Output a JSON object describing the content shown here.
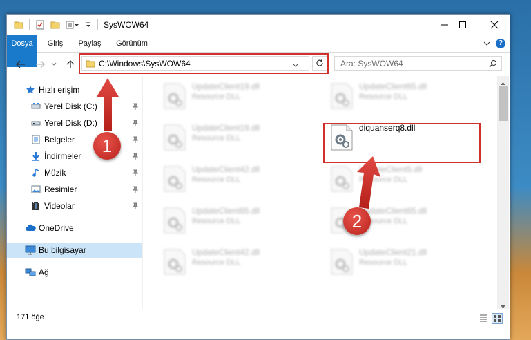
{
  "window": {
    "title": "SysWOW64",
    "controls": {
      "minimize": "—",
      "maximize": "☐",
      "close": "✕"
    }
  },
  "ribbon": {
    "tabs": [
      {
        "label": "Dosya",
        "active": true
      },
      {
        "label": "Giriş"
      },
      {
        "label": "Paylaş"
      },
      {
        "label": "Görünüm"
      }
    ],
    "help_label": "?"
  },
  "navigation": {
    "address": "C:\\Windows\\SysWOW64",
    "search_placeholder": "Ara: SysWOW64"
  },
  "sidebar": {
    "items": [
      {
        "label": "Hızlı erişim",
        "icon": "star-icon",
        "pinned": false
      },
      {
        "label": "Yerel Disk (C:)",
        "icon": "disk-icon",
        "pinned": true
      },
      {
        "label": "Yerel Disk (D:)",
        "icon": "disk-icon",
        "pinned": true
      },
      {
        "label": "Belgeler",
        "icon": "documents-icon",
        "pinned": true
      },
      {
        "label": "İndirmeler",
        "icon": "download-icon",
        "pinned": true
      },
      {
        "label": "Müzik",
        "icon": "music-icon",
        "pinned": true
      },
      {
        "label": "Resimler",
        "icon": "pictures-icon",
        "pinned": true
      },
      {
        "label": "Videolar",
        "icon": "video-icon",
        "pinned": true
      },
      {
        "label": "OneDrive",
        "icon": "cloud-icon",
        "pinned": false
      },
      {
        "label": "Bu bilgisayar",
        "icon": "computer-icon",
        "pinned": false,
        "selected": true
      },
      {
        "label": "Ağ",
        "icon": "network-icon",
        "pinned": false
      }
    ]
  },
  "files": [
    {
      "name": "UpdateClient19.dll",
      "type": "Resource DLL",
      "blurred": true
    },
    {
      "name": "UpdateClient65.dll",
      "type": "Resource DLL",
      "blurred": true
    },
    {
      "name": "UpdateClient19.dll",
      "type": "Resource DLL",
      "blurred": true
    },
    {
      "name": "diquanserq8.dll",
      "type": "",
      "blurred": false,
      "highlighted": true
    },
    {
      "name": "UpdateClient42.dll",
      "type": "Resource DLL",
      "blurred": true
    },
    {
      "name": "UpdateClient5.dll",
      "type": "Resource DLL",
      "blurred": true
    },
    {
      "name": "UpdateClient65.dll",
      "type": "Resource DLL",
      "blurred": true
    },
    {
      "name": "UpdateClient65.dll",
      "type": "Resource DLL",
      "blurred": true
    },
    {
      "name": "UpdateClient42.dll",
      "type": "Resource DLL",
      "blurred": true
    },
    {
      "name": "UpdateClient21.dll",
      "type": "Resource DLL",
      "blurred": true
    }
  ],
  "status": {
    "item_count": "171 öğe"
  },
  "callouts": [
    {
      "number": "1"
    },
    {
      "number": "2"
    }
  ],
  "colors": {
    "accent": "#1979ca",
    "highlight_box": "#d0312d",
    "selected_bg": "#cce4f7"
  }
}
